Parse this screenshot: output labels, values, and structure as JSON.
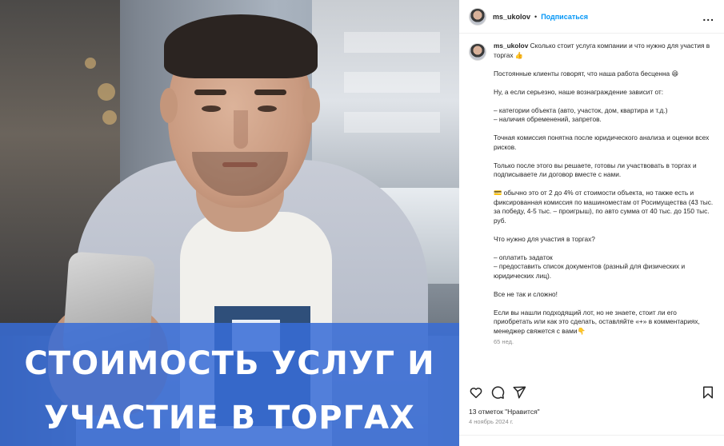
{
  "post": {
    "username": "ms_ukolov",
    "separator": "•",
    "follow_label": "Подписаться",
    "more_label": "...",
    "image": {
      "banner_line_1": "СТОИМОСТЬ УСЛУГ И",
      "banner_line_2": "УЧАСТИЕ В ТОРГАХ"
    },
    "caption": {
      "first_line": "Сколько стоит услуга компании и что нужно для участия в торгах 👍",
      "paragraphs": [
        "Постоянные клиенты говорят, что наша работа бесценна 😄",
        "Ну, а если серьезно, наше вознаграждение зависит от:",
        "– категории объекта (авто, участок, дом, квартира и т.д.)",
        "– наличия обременений, запретов.",
        "Точная комиссия понятна после юридического анализа и оценки всех рисков.",
        "Только после этого вы решаете, готовы ли участвовать в торгах и подписываете ли договор вместе с нами.",
        "💳 обычно это от 2 до 4% от стоимости объекта, но также есть и фиксированная комиссия по машиноместам от Росимущества (43 тыс. за победу, 4-5 тыс. – проигрыш), по авто сумма от 40 тыс. до 150 тыс. руб.",
        "Что нужно для участия в торгах?",
        "– оплатить задаток",
        "– предоставить список документов (разный для физических и юридических лиц).",
        "Все не так и сложно!",
        "Если вы нашли подходящий лот, но не знаете, стоит ли его приобретать или как это сделать, оставляйте «+» в комментариях, менеджер свяжется с вами👇"
      ],
      "time_ago": "65 нед."
    },
    "actions": {
      "like_icon": "heart-icon",
      "comment_icon": "comment-icon",
      "share_icon": "share-icon",
      "save_icon": "bookmark-icon"
    },
    "likes_text": "13 отметок \"Нравится\"",
    "date_text": "4 ноябрь 2024 г."
  }
}
